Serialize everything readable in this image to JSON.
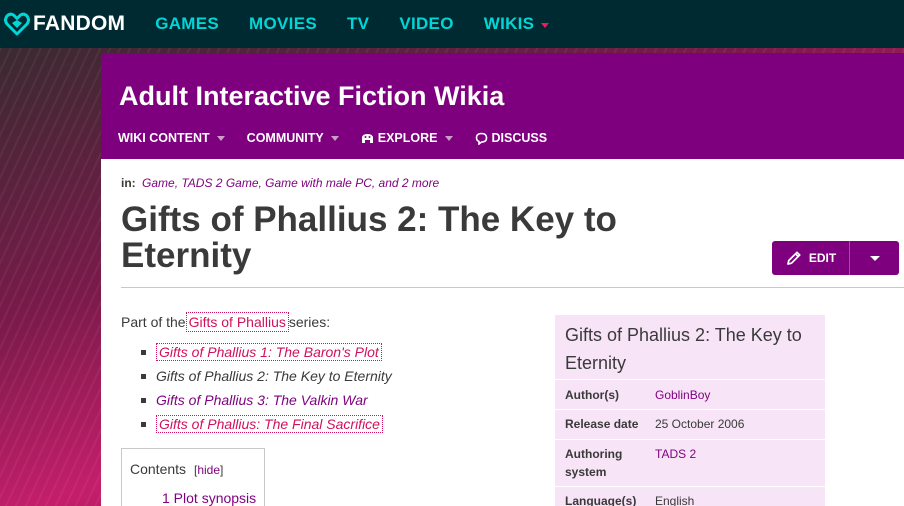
{
  "global_nav": {
    "logo_text": "FANDOM",
    "links": [
      "GAMES",
      "MOVIES",
      "TV",
      "VIDEO",
      "WIKIS"
    ]
  },
  "wiki": {
    "title": "Adult Interactive Fiction Wikia",
    "nav": {
      "wiki_content": "WIKI CONTENT",
      "community": "COMMUNITY",
      "explore": "EXPLORE",
      "discuss": "DISCUSS"
    }
  },
  "page": {
    "categories_label": "in:",
    "categories": "Game, TADS 2 Game, Game with male PC, and 2 more",
    "title": "Gifts of Phallius 2: The Key to Eternity",
    "edit_label": "EDIT",
    "series_intro_before": "Part of the",
    "series_link": "Gifts of Phallius",
    "series_intro_after": "series:",
    "series_items": [
      "Gifts of Phallius 1: The Baron's Plot",
      "Gifts of Phallius 2: The Key to Eternity",
      "Gifts of Phallius 3: The Valkin War",
      "Gifts of Phallius: The Final Sacrifice"
    ],
    "toc": {
      "title": "Contents",
      "hide_open": "[",
      "hide_label": "hide",
      "hide_close": "]",
      "items": [
        "1 Plot synopsis"
      ]
    }
  },
  "infobox": {
    "title": "Gifts of Phallius 2: The Key to Eternity",
    "rows": [
      {
        "label": "Author(s)",
        "value": "GoblinBoy"
      },
      {
        "label": "Release date",
        "value": "25 October 2006"
      },
      {
        "label": "Authoring system",
        "value": "TADS 2"
      },
      {
        "label": "Language(s)",
        "value": "English"
      }
    ]
  },
  "colors": {
    "global_nav_bg": "#002a32",
    "global_nav_link": "#00d6d6",
    "wiki_header_bg": "#7f007f",
    "link": "#7f007f",
    "link_new": "#d0115e",
    "infobox_bg": "#f7e4f7"
  }
}
